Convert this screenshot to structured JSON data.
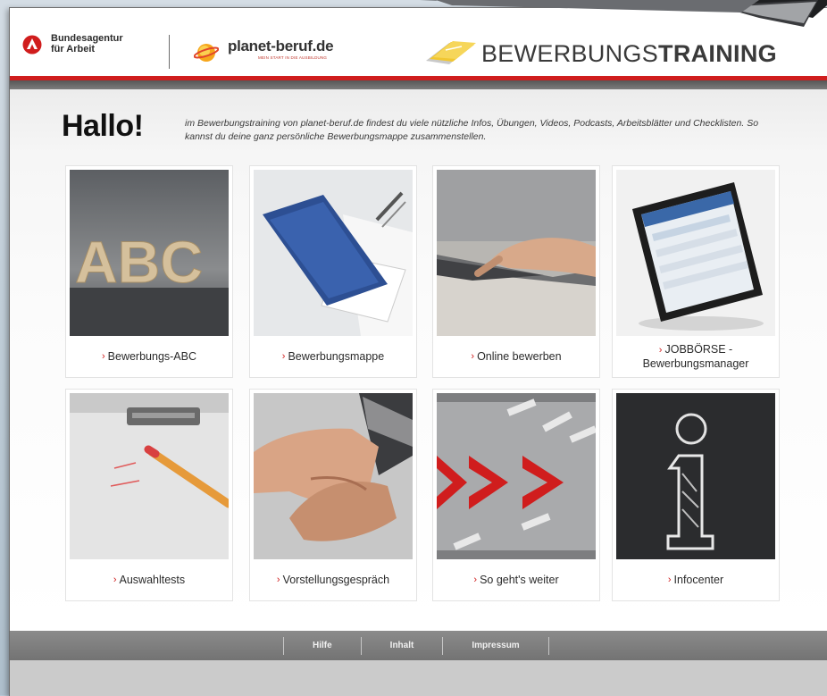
{
  "header": {
    "ba_logo_line1": "Bundesagentur",
    "ba_logo_line2": "für Arbeit",
    "planet_logo": "planet-beruf.de",
    "planet_tagline": "MEIN START IN DIE AUSBILDUNG",
    "app_title_regular": "BEWERBUNGS",
    "app_title_bold": "TRAINING"
  },
  "intro": {
    "greeting": "Hallo!",
    "text": "im Bewerbungstraining von planet-beruf.de findest du viele nützliche Infos, Übungen, Videos, Podcasts, Arbeitsblätter und Checklisten. So kannst du deine ganz persönliche Bewerbungsmappe zusammenstellen."
  },
  "tiles": [
    {
      "label": "Bewerbungs-ABC",
      "image": "wooden-abc-letters"
    },
    {
      "label": "Bewerbungsmappe",
      "image": "blue-folder-and-pen"
    },
    {
      "label": "Online bewerben",
      "image": "hand-on-laptop"
    },
    {
      "label_line1": "JOBBÖRSE -",
      "label_line2": "Bewerbungsmanager",
      "image": "tablet"
    },
    {
      "label": "Auswahltests",
      "image": "clipboard-and-pencil"
    },
    {
      "label": "Vorstellungsgespräch",
      "image": "handshake"
    },
    {
      "label": "So geht's weiter",
      "image": "red-arrows"
    },
    {
      "label": "Infocenter",
      "image": "chalk-info-sign"
    }
  ],
  "footer": {
    "links": [
      "Hilfe",
      "Inhalt",
      "Impressum"
    ]
  },
  "colors": {
    "accent_red": "#d01d1d",
    "footer_gray": "#7f7f7f"
  }
}
